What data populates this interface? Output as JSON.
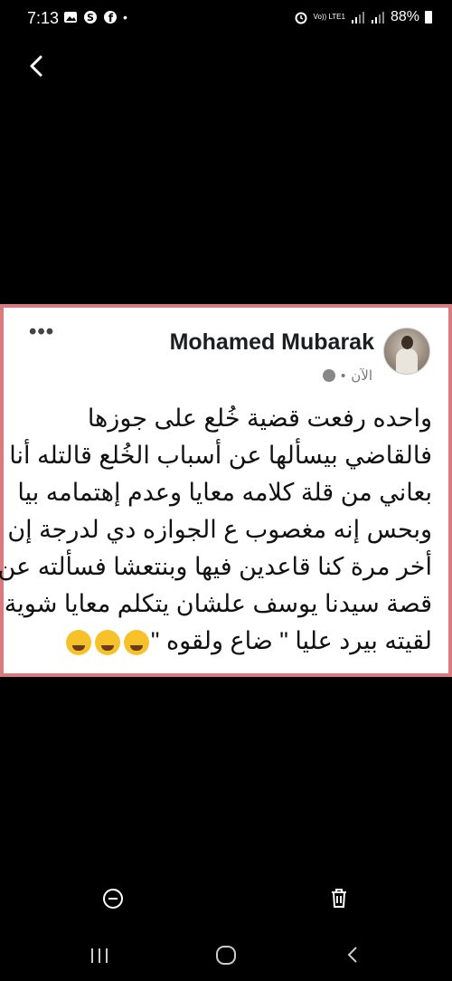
{
  "status_bar": {
    "time": "7:13",
    "network_label": "Vo)) LTE1",
    "battery": "88%"
  },
  "post": {
    "author": "Mohamed Mubarak",
    "timestamp": "الآن",
    "lines": [
      "واحده رفعت قضية خُلع على جوزها",
      "فالقاضي بيسألها عن أسباب الخُلع قالتله أنا",
      "بعاني من قلة كلامه معايا وعدم إهتمامه بيا",
      "وبحس إنه مغصوب ع الجوازه دي لدرجة إن",
      "أخر مرة كنا قاعدين فيها وبنتعشا فسألته عن",
      "قصة سيدنا يوسف علشان يتكلم معايا شوية",
      "لقيته بيرد عليا \" ضاع ولقوه \""
    ],
    "emoji_icons": [
      "rolling-eyes-emoji",
      "smirk-emoji",
      "tears-of-joy-emoji"
    ]
  },
  "icons": {
    "back": "back-arrow-icon",
    "minus": "remove-circle-icon",
    "delete": "trash-icon",
    "nav_recent": "recent-apps-icon",
    "nav_home": "home-icon",
    "nav_back": "nav-back-icon"
  }
}
